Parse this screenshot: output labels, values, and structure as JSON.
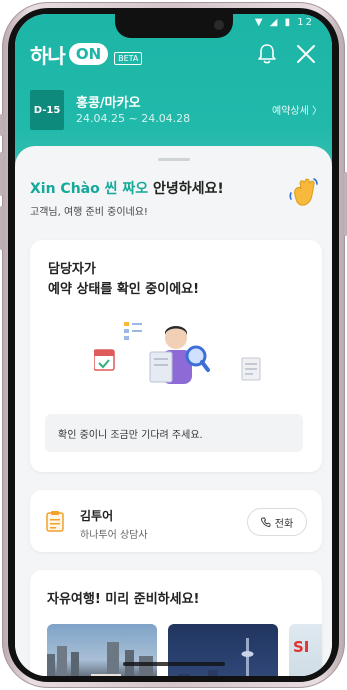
{
  "app": {
    "logo_text": "하나",
    "logo_badge": "ON",
    "beta_label": "BETA",
    "status_icons": "▼ ◢ ▮ 12"
  },
  "trip": {
    "dday": "D-15",
    "title": "홍콩/마카오",
    "dates": "24.04.25 ~ 24.04.28",
    "detail_link": "예약상세 〉"
  },
  "greeting": {
    "name": "Xin Chào 씬 짜오",
    "suffix": " 안녕하세요!",
    "subtitle": "고객님, 여행 준비 중이네요!"
  },
  "status_card": {
    "title_line1": "담당자가",
    "title_line2": "예약 상태를 확인 중이에요!",
    "notice": "확인 중이니 조금만 기다려 주세요."
  },
  "agent": {
    "name": "김투어",
    "role": "하나투어 상담사",
    "call_label": "전화"
  },
  "free_travel": {
    "title": "자유여행! 미리 준비하세요!",
    "thumb3_text": "SI"
  },
  "colors": {
    "brand_teal": "#1cb5a6",
    "dday_bg": "#0e8a7d",
    "greeting_accent": "#14a999"
  }
}
